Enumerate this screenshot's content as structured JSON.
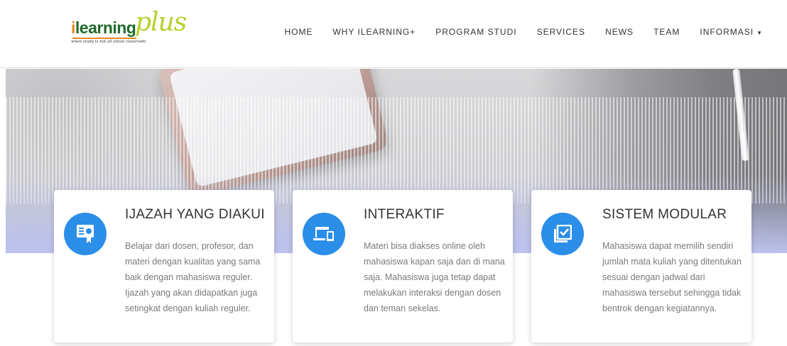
{
  "brand": {
    "logo_i": "i",
    "logo_main": "learning",
    "logo_plus": "plus",
    "tagline": "when study is not all about classroom",
    "colors": {
      "green": "#1f6b2b",
      "orange": "#e6891e",
      "lime": "#b7d02c"
    }
  },
  "nav": {
    "items": [
      {
        "label": "HOME"
      },
      {
        "label": "WHY ILEARNING+"
      },
      {
        "label": "PROGRAM STUDI"
      },
      {
        "label": "SERVICES"
      },
      {
        "label": "NEWS"
      },
      {
        "label": "TEAM"
      },
      {
        "label": "INFORMASI",
        "caret": "▼"
      }
    ]
  },
  "accent_color": "#2b8ee8",
  "cards": [
    {
      "icon": "certificate-icon",
      "title": "IJAZAH YANG DIAKUI",
      "desc": "Belajar dari dosen, profesor, dan materi dengan kualitas yang sama baik dengan mahasiswa reguler. Ijazah yang akan didapatkan juga setingkat dengan kuliah reguler."
    },
    {
      "icon": "devices-icon",
      "title": "INTERAKTIF",
      "desc": "Materi bisa diakses online oleh mahasiswa kapan saja dan di mana saja. Mahasiswa juga tetap dapat melakukan interaksi dengan dosen dan teman sekelas."
    },
    {
      "icon": "checklist-icon",
      "title": "SISTEM MODULAR",
      "desc": "Mahasiswa dapat memilih sendiri jumlah mata kuliah  yang ditentukan sesuai dengan jadwal dari mahasiswa tersebut sehingga tidak bentrok dengan kegiatannya."
    }
  ]
}
